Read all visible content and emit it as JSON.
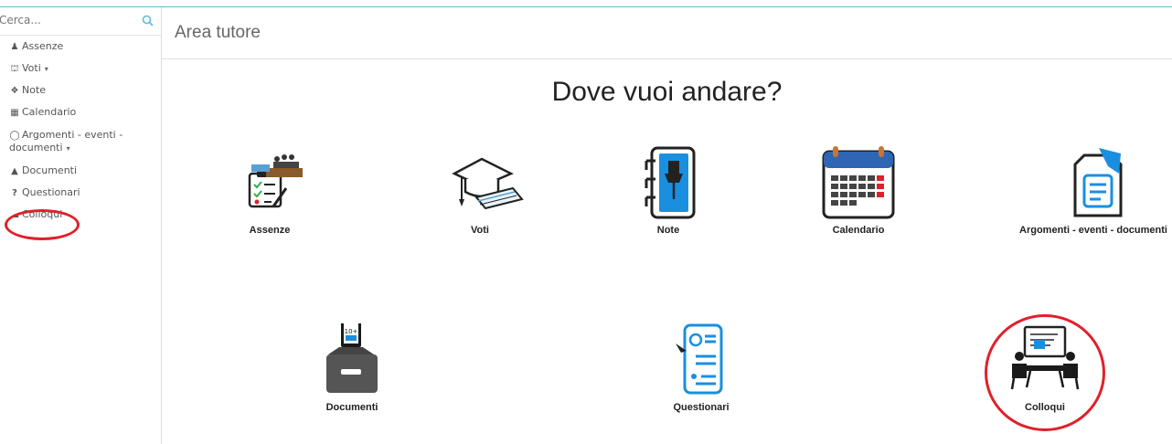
{
  "search": {
    "placeholder": "Cerca..."
  },
  "sidebar": {
    "items": [
      {
        "label": "Assenze",
        "icon": "user-icon"
      },
      {
        "label": "Voti",
        "icon": "institution-icon",
        "caret": "▾"
      },
      {
        "label": "Note",
        "icon": "pin-icon"
      },
      {
        "label": "Calendario",
        "icon": "calendar-icon"
      },
      {
        "label": "Argomenti - eventi -",
        "label2": "documenti",
        "icon": "folder-open-icon",
        "caret": "▾"
      },
      {
        "label": "Documenti",
        "icon": "graduation-cap-icon"
      },
      {
        "label": "Questionari",
        "icon": "question-icon"
      },
      {
        "label": "Colloqui",
        "icon": "comments-icon"
      }
    ]
  },
  "header": {
    "title": "Area tutore"
  },
  "main": {
    "heading": "Dove vuoi andare?",
    "tiles": [
      {
        "label": "Assenze"
      },
      {
        "label": "Voti"
      },
      {
        "label": "Note"
      },
      {
        "label": "Calendario"
      },
      {
        "label": "Argomenti - eventi - documenti"
      },
      {
        "label": "Documenti"
      },
      {
        "label": "Questionari"
      },
      {
        "label": "Colloqui"
      }
    ]
  },
  "icons": {
    "doc_badge": "10+"
  },
  "colors": {
    "accent": "#5bc0de",
    "annotation": "#e0202a",
    "tile_blue": "#1a8fe0",
    "calendar_blue": "#2f66b3"
  }
}
